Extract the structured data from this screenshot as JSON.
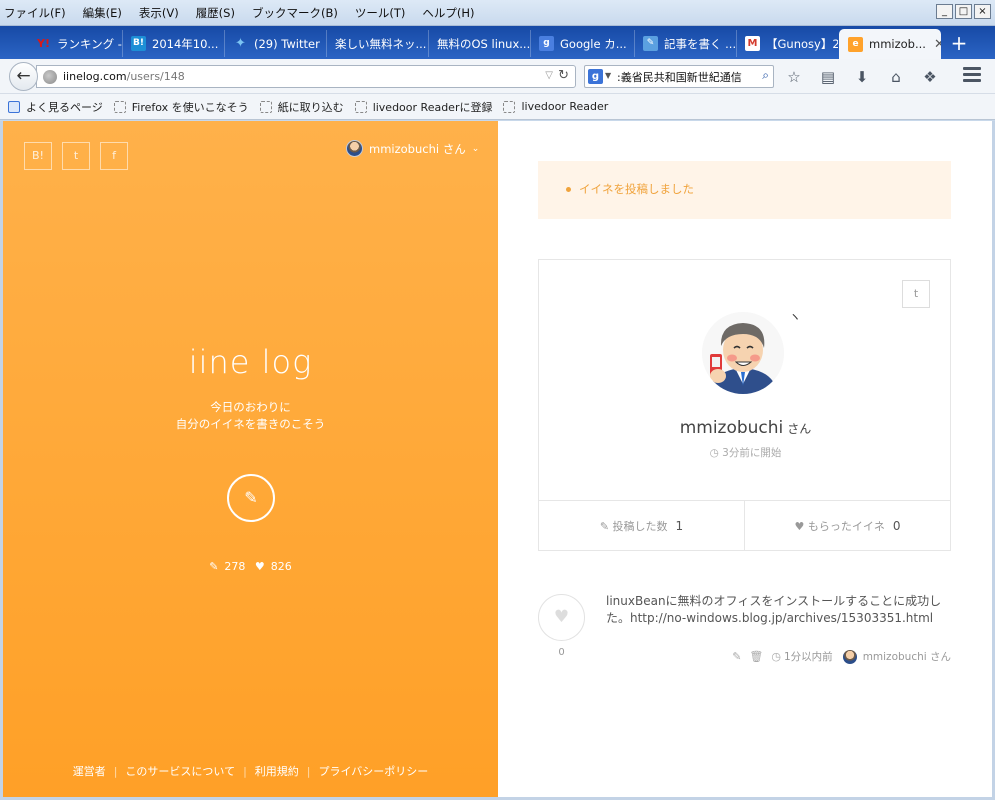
{
  "menu": [
    "ファイル(F)",
    "編集(E)",
    "表示(V)",
    "履歴(S)",
    "ブックマーク(B)",
    "ツール(T)",
    "ヘルプ(H)"
  ],
  "tabs": [
    {
      "label": "ランキング - ...",
      "icon": "yahoo-icon",
      "color": "#d61a1a"
    },
    {
      "label": "2014年10...",
      "icon": "hatena-icon",
      "color": "#1d8fd6"
    },
    {
      "label": "(29) Twitter",
      "icon": "twitter-icon",
      "color": "#3aa3e3"
    },
    {
      "label": "楽しい無料ネッ...",
      "icon": "",
      "color": ""
    },
    {
      "label": "無料のOS linux...",
      "icon": "",
      "color": ""
    },
    {
      "label": "Google カ...",
      "icon": "google-icon",
      "color": "#4a7fe0"
    },
    {
      "label": "記事を書く ...",
      "icon": "livedoor-icon",
      "color": "#5ba0e0"
    },
    {
      "label": "【Gunosy】2...",
      "icon": "gmail-icon",
      "color": "#d33b2d"
    },
    {
      "label": "mmizob...",
      "icon": "iine-icon",
      "color": "#ffa22b",
      "active": true
    }
  ],
  "nav": {
    "url_host": "iinelog.com",
    "url_path": "/users/148",
    "search_value": ":義省民共和国新世紀通信"
  },
  "bookmarks": [
    "よく見るページ",
    "Firefox を使いこなそう",
    "紙に取り込む",
    "livedoor Readerに登録",
    "livedoor Reader"
  ],
  "left": {
    "share_buttons": [
      "B!",
      "t",
      "f"
    ],
    "user": "mmizobuchi さん",
    "logo": "iine log",
    "tagline_1": "今日のおわりに",
    "tagline_2": "自分のイイネを書きのこそう",
    "post_count": "278",
    "like_count": "826",
    "footer": [
      "運営者",
      "このサービスについて",
      "利用規約",
      "プライバシーポリシー"
    ]
  },
  "notice": "イイネを投稿しました",
  "profile": {
    "name": "mmizobuchi",
    "suffix": "さん",
    "started": "3分前に開始",
    "posts_label": "投稿した数",
    "posts_value": "1",
    "likes_label": "もらったイイネ",
    "likes_value": "0"
  },
  "post": {
    "like_count": "0",
    "text": "linuxBeanに無料のオフィスをインストールすることに成功した。http://no-windows.blog.jp/archives/15303351.html",
    "time": "1分以内前",
    "author": "mmizobuchi さん"
  },
  "colors": {
    "accent": "#ffa22b",
    "notice_bg": "#fff4e8",
    "notice_text": "#f0a33c"
  }
}
